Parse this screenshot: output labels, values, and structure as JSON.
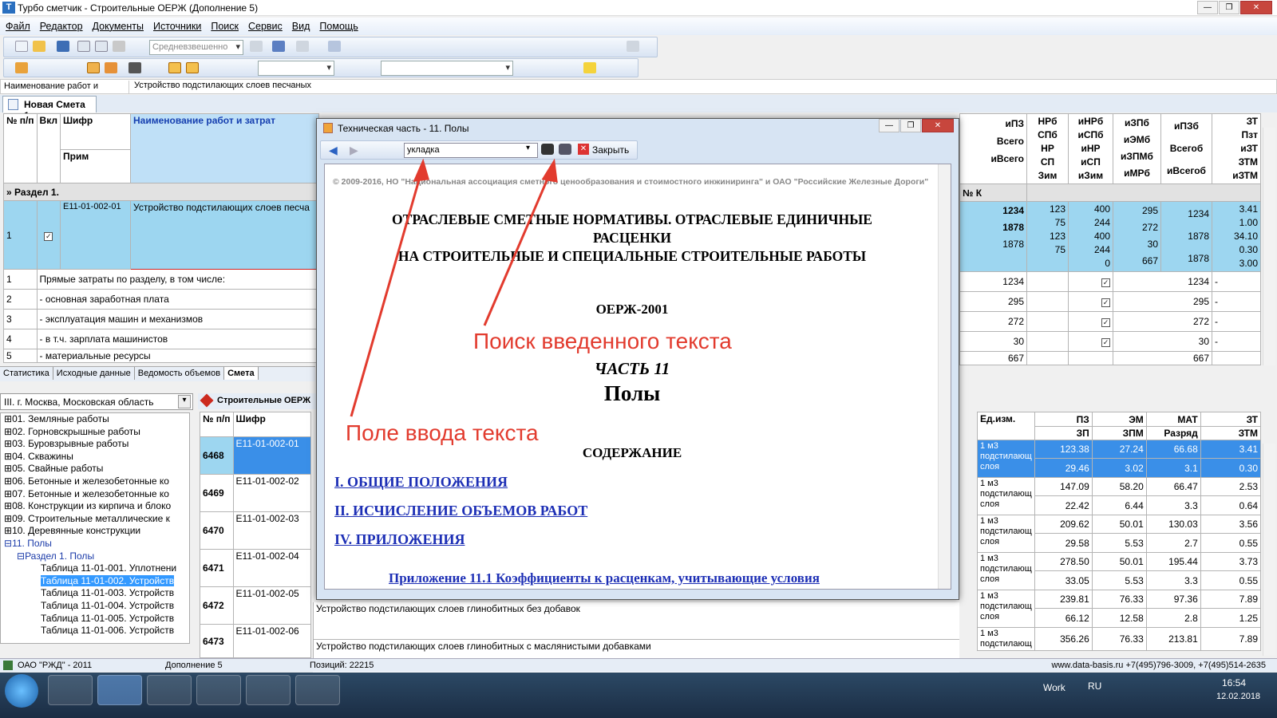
{
  "window": {
    "title": "Турбо сметчик - Строительные ОЕРЖ (Дополнение 5)",
    "logo": "Т"
  },
  "menu": [
    "Файл",
    "Редактор",
    "Документы",
    "Источники",
    "Поиск",
    "Сервис",
    "Вид",
    "Помощь"
  ],
  "toolbar": {
    "combo_value": "Средневзвешенно"
  },
  "formula": {
    "label": "Наименование работ и",
    "value": "Устройство подстилающих слоев песчаных"
  },
  "doc_tab": "Новая Смета 1",
  "estimate": {
    "headers": {
      "num": "№ п/п",
      "incl": "Вкл",
      "code": "Шифр",
      "note": "Прим",
      "name": "Наименование работ и затрат"
    },
    "right_headers": [
      [
        "иПЗ",
        "Всего",
        "иВсего",
        "№ К"
      ],
      [
        "НРб",
        "СПб",
        "НР",
        "СП",
        "Зим"
      ],
      [
        "иНРб",
        "иСПб",
        "иНР",
        "иСП",
        "иЗим"
      ],
      [
        "иЗПб",
        "иЭМб",
        "иЗПМб",
        "иМРб"
      ],
      [
        "иПЗб",
        "Всегоб",
        "иВсегоб"
      ],
      [
        "ЗТ",
        "Пзт",
        "иЗТ",
        "ЗТМ",
        "иЗТМ"
      ]
    ],
    "section": "Раздел 1.",
    "item": {
      "num": "1",
      "code": "Е11-01-002-01",
      "name": "Устройство подстилающих слоев песча",
      "v1": [
        "1234",
        "1878",
        "1878"
      ],
      "v2": [
        "123",
        "75",
        "123",
        "75"
      ],
      "v3": [
        "400",
        "244",
        "400",
        "244",
        "0"
      ],
      "v4": [
        "295",
        "272",
        "30",
        "667"
      ],
      "v5": [
        "1234",
        "1878",
        "1878"
      ],
      "v6": [
        "3.41",
        "1.00",
        "34.10",
        "0.30",
        "3.00"
      ]
    },
    "rows": [
      {
        "num": "1",
        "text": "Прямые затраты по разделу, в том числе:",
        "v": "1234",
        "v2": "1234",
        "d": "-"
      },
      {
        "num": "2",
        "text": " - основная заработная плата",
        "v": "295",
        "v2": "295",
        "d": "-"
      },
      {
        "num": "3",
        "text": " - эксплуатация машин и механизмов",
        "v": "272",
        "v2": "272",
        "d": "-"
      },
      {
        "num": "4",
        "text": "  - в т.ч. зарплата машинистов",
        "v": "30",
        "v2": "30",
        "d": "-"
      },
      {
        "num": "5",
        "text": " - материальные ресурсы",
        "v": "667",
        "v2": "667",
        "d": ""
      }
    ]
  },
  "bottom_tabs": [
    "Статистика",
    "Исходные данные",
    "Ведомость объемов",
    "Смета"
  ],
  "region": "III. г. Москва, Московская область",
  "tree": [
    "01. Земляные работы",
    "02. Горновскрышные работы",
    "03. Буровзрывные работы",
    "04. Скважины",
    "05. Свайные работы",
    "06. Бетонные и железобетонные ко",
    "07. Бетонные и железобетонные ко",
    "08. Конструкции из кирпича и блоко",
    "09. Строительные металлические к",
    "10. Деревянные конструкции",
    "11. Полы",
    "Раздел 1. Полы",
    "Таблица 11-01-001. Уплотнени",
    "Таблица 11-01-002. Устройств",
    "Таблица 11-01-003. Устройств",
    "Таблица 11-01-004. Устройств",
    "Таблица 11-01-005. Устройств",
    "Таблица 11-01-006. Устройств"
  ],
  "norms": {
    "title": "Строительные ОЕРЖ",
    "headers": {
      "num": "№ п/п",
      "code": "Шифр",
      "unit": "Ед.изм.",
      "pz": "ПЗ",
      "em": "ЭМ",
      "mat": "МАТ",
      "zt": "ЗТ",
      "zp": "ЗП",
      "zpm": "ЗПМ",
      "razr": "Разряд",
      "ztm": "ЗТМ"
    },
    "rows": [
      {
        "num": "6468",
        "code": "Е11-01-002-01",
        "name": "",
        "unit": "1 м3 подстилающ слоя",
        "a": [
          "123.38",
          "27.24",
          "66.68",
          "3.41"
        ],
        "b": [
          "29.46",
          "3.02",
          "3.1",
          "0.30"
        ]
      },
      {
        "num": "6469",
        "code": "Е11-01-002-02",
        "name": "",
        "unit": "1 м3 подстилающ слоя",
        "a": [
          "147.09",
          "58.20",
          "66.47",
          "2.53"
        ],
        "b": [
          "22.42",
          "6.44",
          "3.3",
          "0.64"
        ]
      },
      {
        "num": "6470",
        "code": "Е11-01-002-03",
        "name": "",
        "unit": "1 м3 подстилающ слоя",
        "a": [
          "209.62",
          "50.01",
          "130.03",
          "3.56"
        ],
        "b": [
          "29.58",
          "5.53",
          "2.7",
          "0.55"
        ]
      },
      {
        "num": "6471",
        "code": "Е11-01-002-04",
        "name": "",
        "unit": "1 м3 подстилающ слоя",
        "a": [
          "278.50",
          "50.01",
          "195.44",
          "3.73"
        ],
        "b": [
          "33.05",
          "5.53",
          "3.3",
          "0.55"
        ]
      },
      {
        "num": "6472",
        "code": "Е11-01-002-05",
        "name": "Устройство подстилающих слоев глинобитных без добавок",
        "unit": "1 м3 подстилающ слоя",
        "a": [
          "239.81",
          "76.33",
          "97.36",
          "7.89"
        ],
        "b": [
          "66.12",
          "12.58",
          "2.8",
          "1.25"
        ]
      },
      {
        "num": "6473",
        "code": "Е11-01-002-06",
        "name": "Устройство подстилающих слоев глинобитных с маслянистыми добавками",
        "unit": "1 м3 подстилающ",
        "a": [
          "356.26",
          "76.33",
          "213.81",
          "7.89"
        ],
        "b": [
          "",
          "",
          "",
          ""
        ]
      }
    ]
  },
  "dialog": {
    "title": "Техническая часть - 11. Полы",
    "search_value": "укладка",
    "close_label": "Закрыть",
    "copyright": "© 2009-2016, НО \"Национальная ассоциация сметного ценообразования и стоимостного инжиниринга\" и ОАО \"Российские Железные Дороги\"",
    "heading1": "ОТРАСЛЕВЫЕ СМЕТНЫЕ НОРМАТИВЫ. ОТРАСЛЕВЫЕ ЕДИНИЧНЫЕ",
    "heading2": "РАСЦЕНКИ",
    "heading3": "НА СТРОИТЕЛЬНЫЕ И СПЕЦИАЛЬНЫЕ СТРОИТЕЛЬНЫЕ РАБОТЫ",
    "code": "ОЕРЖ-2001",
    "part": "ЧАСТЬ 11",
    "part_name": "Полы",
    "contents": "СОДЕРЖАНИЕ",
    "links": [
      "I. ОБЩИЕ ПОЛОЖЕНИЯ",
      "II. ИСЧИСЛЕНИЕ ОБЪЕМОВ РАБОТ",
      "IV. ПРИЛОЖЕНИЯ"
    ],
    "cut_text": "Приложение 11.1 Коэффициенты к расценкам, учитывающие условия"
  },
  "annotations": {
    "search": "Поиск введенного текста",
    "field": "Поле ввода текста",
    "color": "#e23b2e"
  },
  "status": {
    "org": "ОАО \"РЖД\" - 2011",
    "addition": "Дополнение 5",
    "positions": "Позиций: 22215",
    "contacts": "www.data-basis.ru  +7(495)796-3009, +7(495)514-2635"
  },
  "taskbar": {
    "work": "Work",
    "lang": "RU",
    "time": "16:54",
    "date": "12.02.2018"
  }
}
